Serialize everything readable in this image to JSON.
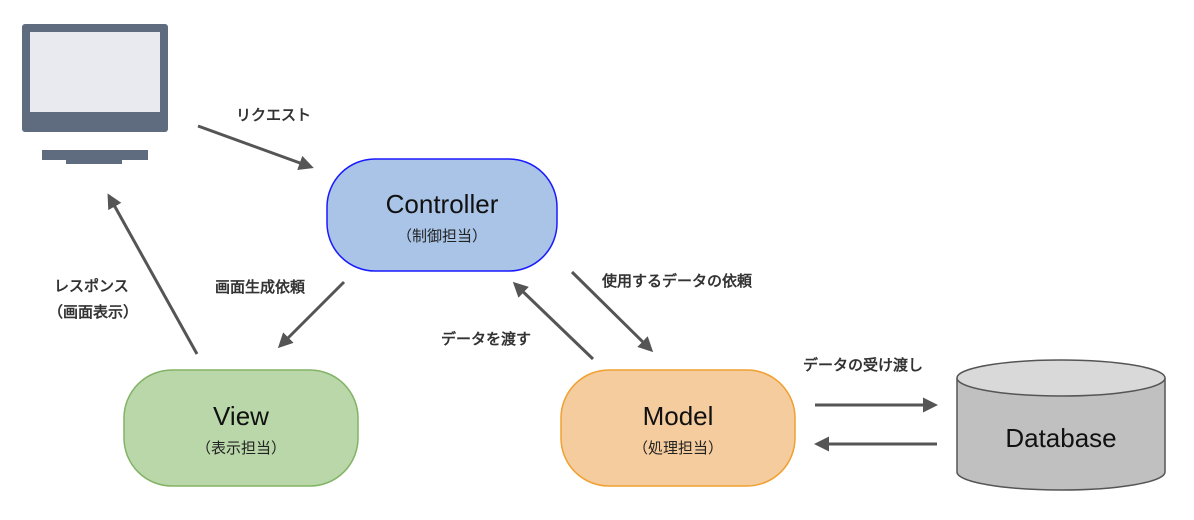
{
  "nodes": {
    "controller": {
      "title": "Controller",
      "subtitle": "（制御担当）"
    },
    "view": {
      "title": "View",
      "subtitle": "（表示担当）"
    },
    "model": {
      "title": "Model",
      "subtitle": "（処理担当）"
    },
    "database": {
      "title": "Database"
    }
  },
  "edges": {
    "request": "リクエスト",
    "response_line1": "レスポンス",
    "response_line2": "（画面表示）",
    "render_request": "画面生成依頼",
    "data_request": "使用するデータの依頼",
    "pass_data": "データを渡す",
    "db_exchange": "データの受け渡し"
  },
  "colors": {
    "controller_fill": "#a9c4e6",
    "controller_stroke": "#1a1aff",
    "view_fill": "#b9d7a8",
    "view_stroke": "#82b366",
    "model_fill": "#f5cc9e",
    "model_stroke": "#f0a030",
    "database_fill": "#c0c0c0",
    "database_top": "#d9d9d9",
    "monitor": "#5f6b7f",
    "monitor_screen": "#e8eaf0",
    "arrow": "#555555"
  },
  "icons": {
    "client": "computer-monitor-icon",
    "database": "database-cylinder-icon"
  }
}
